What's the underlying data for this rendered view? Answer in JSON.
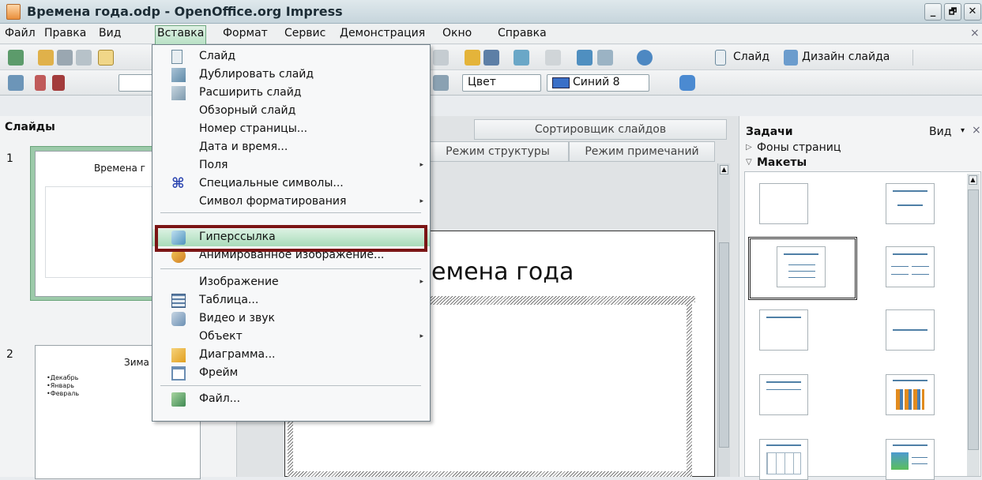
{
  "window": {
    "title": "Времена года.odp - OpenOffice.org Impress",
    "buttons": [
      "_",
      "🗗",
      "✕"
    ]
  },
  "menubar": {
    "items": [
      "Файл",
      "Правка",
      "Вид",
      "Вставка",
      "Формат",
      "Сервис",
      "Демонстрация",
      "Окно",
      "Справка"
    ],
    "close": "×"
  },
  "toolbar1": {
    "slide_label": "Слайд",
    "design_label": "Дизайн слайда"
  },
  "toolbar2": {
    "color_mode": "Цвет",
    "color_value": "Синий 8"
  },
  "insert_menu": {
    "items": [
      {
        "label": "Слайд",
        "icon": "slide-icon"
      },
      {
        "label": "Дублировать слайд",
        "icon": "duplicate-slide-icon"
      },
      {
        "label": "Расширить слайд",
        "icon": "expand-slide-icon"
      },
      {
        "label": "Обзорный слайд",
        "icon": ""
      },
      {
        "label": "Номер страницы...",
        "icon": ""
      },
      {
        "label": "Дата и время...",
        "icon": ""
      },
      {
        "label": "Поля",
        "icon": "",
        "submenu": true
      },
      {
        "label": "Специальные символы...",
        "icon": "special-chars-icon"
      },
      {
        "label": "Символ форматирования",
        "icon": "",
        "submenu": true
      },
      {
        "label": "Гиперссылка",
        "icon": "hyperlink-icon",
        "highlighted": true
      },
      {
        "label": "Анимированное изображение...",
        "icon": "animated-image-icon"
      },
      {
        "label": "Изображение",
        "icon": "",
        "submenu": true
      },
      {
        "label": "Таблица...",
        "icon": "table-icon"
      },
      {
        "label": "Видео и звук",
        "icon": "video-audio-icon"
      },
      {
        "label": "Объект",
        "icon": "",
        "submenu": true
      },
      {
        "label": "Диаграмма...",
        "icon": "chart-icon"
      },
      {
        "label": "Фрейм",
        "icon": "frame-icon"
      },
      {
        "label": "Файл...",
        "icon": "file-icon"
      }
    ]
  },
  "slides_pane": {
    "title": "Слайды",
    "slides": [
      {
        "number": "1",
        "title": "Времена г"
      },
      {
        "number": "2",
        "title": "Зима",
        "bullets": [
          "•Декабрь",
          "•Январь",
          "•Февраль"
        ]
      }
    ]
  },
  "center": {
    "tabs": [
      "Сортировщик слайдов",
      "Режим структуры",
      "Режим примечаний"
    ],
    "slide_title": "емена года"
  },
  "tasks_pane": {
    "title": "Задачи",
    "view_label": "Вид",
    "sections": [
      {
        "label": "Фоны страниц",
        "collapsed": true
      },
      {
        "label": "Макеты",
        "collapsed": false
      }
    ]
  },
  "colors": {
    "highlight_border": "#7b1515",
    "menu_highlight": "#a9dcba",
    "accent": "#4f7fa6"
  }
}
